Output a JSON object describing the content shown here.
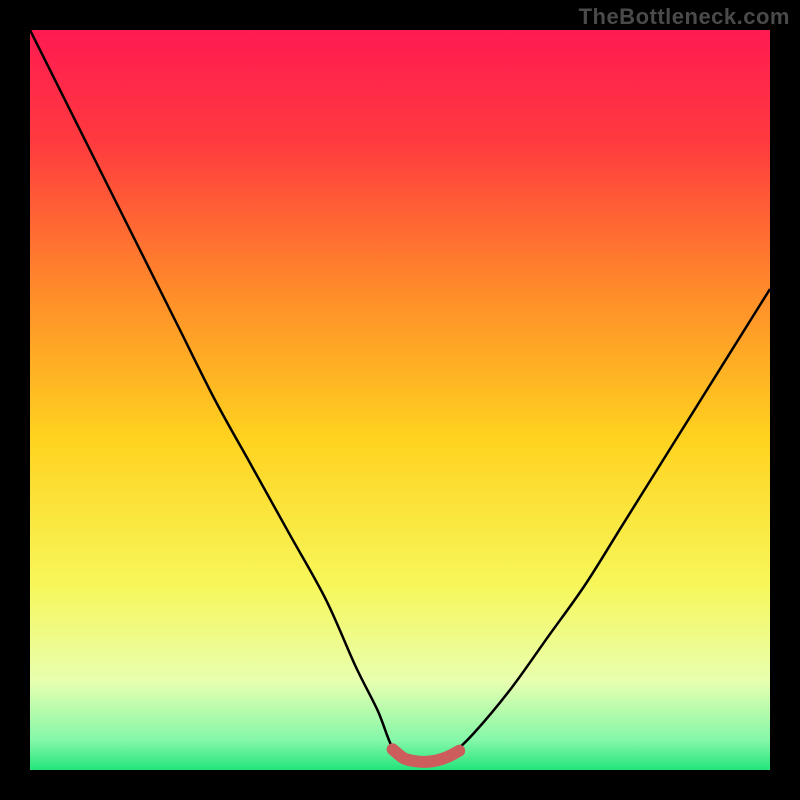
{
  "watermark": {
    "text": "TheBottleneck.com"
  },
  "colors": {
    "background": "#000000",
    "gradient_stops": [
      {
        "offset": 0.0,
        "color": "#ff1a52"
      },
      {
        "offset": 0.15,
        "color": "#ff3a3f"
      },
      {
        "offset": 0.35,
        "color": "#ff8a2a"
      },
      {
        "offset": 0.55,
        "color": "#ffd21f"
      },
      {
        "offset": 0.75,
        "color": "#f7f75a"
      },
      {
        "offset": 0.88,
        "color": "#e8ffb0"
      },
      {
        "offset": 0.96,
        "color": "#84f7a8"
      },
      {
        "offset": 1.0,
        "color": "#22e57a"
      }
    ],
    "curve": "#000000",
    "marker": "#cd5c5c"
  },
  "chart_data": {
    "type": "line",
    "title": "",
    "xlabel": "",
    "ylabel": "",
    "xlim": [
      0,
      100
    ],
    "ylim": [
      0,
      100
    ],
    "series": [
      {
        "name": "bottleneck-curve",
        "x": [
          0,
          5,
          10,
          15,
          20,
          25,
          30,
          35,
          40,
          44,
          47,
          49,
          51,
          53,
          55,
          57,
          60,
          65,
          70,
          75,
          80,
          85,
          90,
          95,
          100
        ],
        "y": [
          100,
          90,
          80,
          70,
          60,
          50,
          41,
          32,
          23,
          14,
          8,
          3,
          1.5,
          1.2,
          1.5,
          2.2,
          5,
          11,
          18,
          25,
          33,
          41,
          49,
          57,
          65
        ]
      },
      {
        "name": "optimal-range-marker",
        "x": [
          49,
          50.5,
          52,
          53.5,
          55,
          56.5,
          58
        ],
        "y": [
          2.8,
          1.6,
          1.2,
          1.1,
          1.3,
          1.8,
          2.6
        ]
      }
    ]
  }
}
